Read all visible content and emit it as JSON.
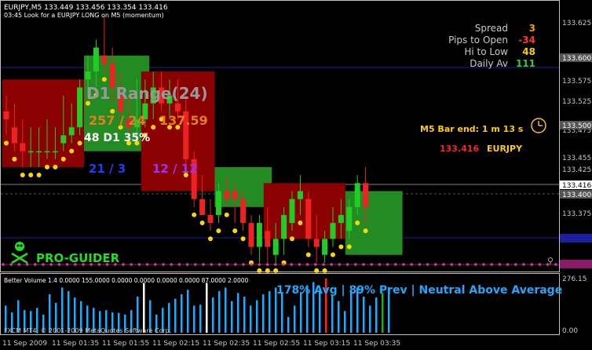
{
  "header": {
    "symbol_line": "EURJPY,M5 133.449 133.456 133.354 133.416",
    "alert_line": "03:45 Look for a EURJPY LONG on M5 (momentum)"
  },
  "info_panel": {
    "spread_label": "Spread",
    "spread_value": "3",
    "pips_label": "Pips to Open",
    "pips_value": "-34",
    "hilo_label": "Hi to Low",
    "hilo_value": "48",
    "daily_label": "Daily Av",
    "daily_value": "111"
  },
  "overlay": {
    "d1_range": "D1 Range(24)",
    "range_counts": "257 / 24",
    "range_price": "137.59",
    "d1_pct": "48  D1 35%",
    "ratio_blue": "21 / 3",
    "ratio_purple": "12 / 12",
    "m5_bar_end": "M5 Bar end: 1 m 13 s",
    "current_price": "133.416",
    "pair": "EURJPY",
    "brand": "PRO-GUIDER"
  },
  "price_axis": {
    "ticks": [
      "133.625",
      "133.575",
      "133.525",
      "133.475",
      "133.455",
      "133.425",
      "133.375"
    ],
    "highlight_labels": [
      "133.600",
      "133.500",
      "133.416",
      "133.400"
    ]
  },
  "volume_panel": {
    "title": "Better Volume 1.4 0.0000 155.0000 0.0000 0.0000 0.0000 0.0000 87.0000 2.0000",
    "summary": "178% Avg | 89% Prev | Neutral Above Average",
    "scale_top": "276.15",
    "scale_bottom": "0.00",
    "copyright": "FXCM MT4, © 2001-2009 MetaQuotes Software Corp."
  },
  "time_axis": {
    "labels": [
      "11 Sep 2009",
      "11 Sep 01:35",
      "11 Sep 01:55",
      "11 Sep 02:15",
      "11 Sep 02:35",
      "11 Sep 02:55",
      "11 Sep 03:15",
      "11 Sep 03:35"
    ]
  },
  "chart_data": {
    "type": "candlestick",
    "symbol": "EURJPY",
    "timeframe": "M5",
    "y_range": [
      133.345,
      133.66
    ],
    "candles": [
      {
        "o": 133.54,
        "h": 133.56,
        "l": 133.51,
        "c": 133.53
      },
      {
        "o": 133.52,
        "h": 133.55,
        "l": 133.49,
        "c": 133.5
      },
      {
        "o": 133.5,
        "h": 133.53,
        "l": 133.47,
        "c": 133.49
      },
      {
        "o": 133.49,
        "h": 133.52,
        "l": 133.47,
        "c": 133.49
      },
      {
        "o": 133.49,
        "h": 133.52,
        "l": 133.47,
        "c": 133.49
      },
      {
        "o": 133.49,
        "h": 133.53,
        "l": 133.48,
        "c": 133.49
      },
      {
        "o": 133.49,
        "h": 133.52,
        "l": 133.48,
        "c": 133.49
      },
      {
        "o": 133.5,
        "h": 133.56,
        "l": 133.49,
        "c": 133.51
      },
      {
        "o": 133.51,
        "h": 133.55,
        "l": 133.5,
        "c": 133.52
      },
      {
        "o": 133.52,
        "h": 133.58,
        "l": 133.51,
        "c": 133.57
      },
      {
        "o": 133.58,
        "h": 133.61,
        "l": 133.56,
        "c": 133.59
      },
      {
        "o": 133.59,
        "h": 133.63,
        "l": 133.57,
        "c": 133.62
      },
      {
        "o": 133.61,
        "h": 133.66,
        "l": 133.59,
        "c": 133.6
      },
      {
        "o": 133.6,
        "h": 133.62,
        "l": 133.55,
        "c": 133.57
      },
      {
        "o": 133.56,
        "h": 133.59,
        "l": 133.53,
        "c": 133.54
      },
      {
        "o": 133.53,
        "h": 133.56,
        "l": 133.51,
        "c": 133.52
      },
      {
        "o": 133.52,
        "h": 133.58,
        "l": 133.51,
        "c": 133.53
      },
      {
        "o": 133.53,
        "h": 133.58,
        "l": 133.52,
        "c": 133.55
      },
      {
        "o": 133.55,
        "h": 133.59,
        "l": 133.53,
        "c": 133.57
      },
      {
        "o": 133.57,
        "h": 133.59,
        "l": 133.54,
        "c": 133.55
      },
      {
        "o": 133.55,
        "h": 133.58,
        "l": 133.53,
        "c": 133.56
      },
      {
        "o": 133.55,
        "h": 133.58,
        "l": 133.53,
        "c": 133.54
      },
      {
        "o": 133.54,
        "h": 133.56,
        "l": 133.47,
        "c": 133.48
      },
      {
        "o": 133.48,
        "h": 133.49,
        "l": 133.42,
        "c": 133.43
      },
      {
        "o": 133.43,
        "h": 133.46,
        "l": 133.41,
        "c": 133.41
      },
      {
        "o": 133.41,
        "h": 133.43,
        "l": 133.39,
        "c": 133.4
      },
      {
        "o": 133.41,
        "h": 133.45,
        "l": 133.4,
        "c": 133.44
      },
      {
        "o": 133.44,
        "h": 133.46,
        "l": 133.42,
        "c": 133.43
      },
      {
        "o": 133.44,
        "h": 133.45,
        "l": 133.4,
        "c": 133.43
      },
      {
        "o": 133.43,
        "h": 133.44,
        "l": 133.39,
        "c": 133.4
      },
      {
        "o": 133.4,
        "h": 133.41,
        "l": 133.36,
        "c": 133.37
      },
      {
        "o": 133.37,
        "h": 133.41,
        "l": 133.35,
        "c": 133.4
      },
      {
        "o": 133.39,
        "h": 133.42,
        "l": 133.35,
        "c": 133.37
      },
      {
        "o": 133.36,
        "h": 133.4,
        "l": 133.35,
        "c": 133.38
      },
      {
        "o": 133.38,
        "h": 133.42,
        "l": 133.36,
        "c": 133.41
      },
      {
        "o": 133.4,
        "h": 133.44,
        "l": 133.39,
        "c": 133.43
      },
      {
        "o": 133.43,
        "h": 133.46,
        "l": 133.41,
        "c": 133.44
      },
      {
        "o": 133.43,
        "h": 133.44,
        "l": 133.37,
        "c": 133.38
      },
      {
        "o": 133.38,
        "h": 133.41,
        "l": 133.35,
        "c": 133.37
      },
      {
        "o": 133.36,
        "h": 133.39,
        "l": 133.35,
        "c": 133.38
      },
      {
        "o": 133.38,
        "h": 133.42,
        "l": 133.37,
        "c": 133.4
      },
      {
        "o": 133.4,
        "h": 133.43,
        "l": 133.38,
        "c": 133.41
      },
      {
        "o": 133.39,
        "h": 133.43,
        "l": 133.38,
        "c": 133.42
      },
      {
        "o": 133.42,
        "h": 133.46,
        "l": 133.41,
        "c": 133.45
      },
      {
        "o": 133.45,
        "h": 133.47,
        "l": 133.4,
        "c": 133.42
      }
    ],
    "zones": [
      {
        "from": 0,
        "to": 9,
        "top": 133.58,
        "bottom": 133.47,
        "color": "#8b0000"
      },
      {
        "from": 10,
        "to": 17,
        "top": 133.61,
        "bottom": 133.49,
        "color": "#228b22"
      },
      {
        "from": 17,
        "to": 25,
        "top": 133.59,
        "bottom": 133.44,
        "color": "#8b0000"
      },
      {
        "from": 26,
        "to": 32,
        "top": 133.47,
        "bottom": 133.42,
        "color": "#228b22"
      },
      {
        "from": 32,
        "to": 41,
        "top": 133.45,
        "bottom": 133.38,
        "color": "#8b0000"
      },
      {
        "from": 42,
        "to": 48,
        "top": 133.44,
        "bottom": 133.36,
        "color": "#228b22"
      }
    ],
    "volume": [
      60,
      45,
      72,
      50,
      48,
      55,
      40,
      85,
      66,
      100,
      92,
      78,
      70,
      60,
      55,
      48,
      50,
      45,
      44,
      40,
      50,
      80,
      110,
      72,
      40,
      55,
      66,
      75,
      85,
      95,
      60,
      62,
      110,
      78,
      92,
      100,
      70,
      88,
      80,
      60,
      72,
      85,
      92,
      100,
      88,
      35,
      60,
      90,
      105,
      112,
      95,
      120,
      84,
      70,
      48,
      92,
      100,
      80,
      60,
      78,
      88,
      100
    ],
    "volume_colors_note": "mostly deepskyblue; red spike at climax bar"
  }
}
